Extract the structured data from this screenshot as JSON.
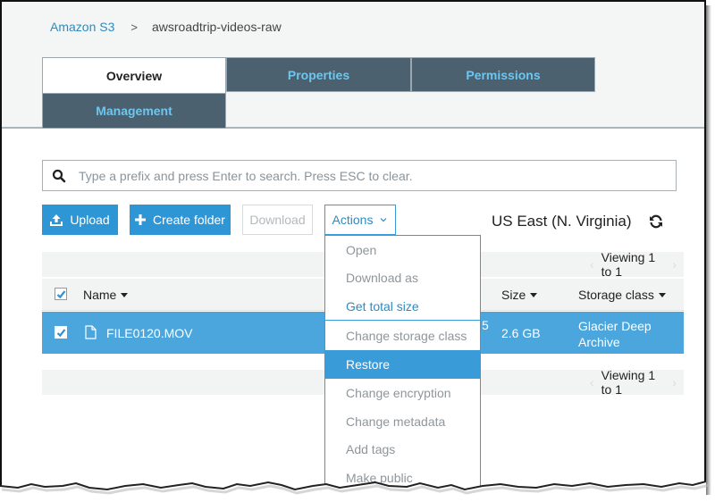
{
  "breadcrumb": {
    "root": "Amazon S3",
    "separator": ">",
    "current": "awsroadtrip-videos-raw"
  },
  "tabs": [
    {
      "label": "Overview",
      "active": true
    },
    {
      "label": "Properties",
      "active": false
    },
    {
      "label": "Permissions",
      "active": false
    },
    {
      "label": "Management",
      "active": false
    }
  ],
  "search": {
    "placeholder": "Type a prefix and press Enter to search. Press ESC to clear.",
    "value": "",
    "icon": "search-icon"
  },
  "toolbar": {
    "upload_label": "Upload",
    "create_folder_label": "Create folder",
    "download_label": "Download",
    "actions_label": "Actions",
    "region": "US East (N. Virginia)",
    "refresh_icon": "refresh-icon"
  },
  "pager": {
    "top_text": "Viewing 1 to 1",
    "bottom_text": "Viewing 1 to 1",
    "prev": "‹",
    "next": "›"
  },
  "table": {
    "columns": {
      "name": "Name",
      "size": "Size",
      "storage_class": "Storage class"
    },
    "header_checked": true,
    "rows": [
      {
        "checked": true,
        "name": "FILE0120.MOV",
        "last_modified_fragment": "5",
        "size": "2.6 GB",
        "storage_class_line1": "Glacier Deep",
        "storage_class_line2": "Archive"
      }
    ]
  },
  "actions_menu": {
    "items": [
      {
        "label": "Open",
        "state": "disabled"
      },
      {
        "label": "Download as",
        "state": "disabled"
      },
      {
        "label": "Get total size",
        "state": "enabled"
      },
      {
        "label": "Change storage class",
        "state": "disabled"
      },
      {
        "label": "Restore",
        "state": "highlighted"
      },
      {
        "label": "Change encryption",
        "state": "disabled"
      },
      {
        "label": "Change metadata",
        "state": "disabled"
      },
      {
        "label": "Add tags",
        "state": "disabled"
      },
      {
        "label": "Make public",
        "state": "disabled"
      }
    ]
  },
  "colors": {
    "primary": "#2f96d6",
    "selected_row": "#4aa6dc",
    "tab_inactive_bg": "#4b6170",
    "tab_inactive_text": "#6ec6ee",
    "link": "#2e8bc0"
  }
}
